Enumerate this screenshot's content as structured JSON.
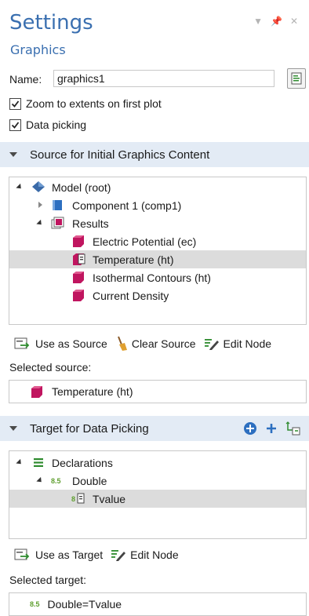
{
  "header": {
    "title": "Settings",
    "subtitle": "Graphics",
    "controls": [
      "dropdown-arrow",
      "pin",
      "close"
    ]
  },
  "name": {
    "label": "Name:",
    "value": "graphics1"
  },
  "options": [
    {
      "label": "Zoom to extents on first plot",
      "checked": true
    },
    {
      "label": "Data picking",
      "checked": true
    }
  ],
  "source_section": {
    "title": "Source for Initial Graphics Content",
    "tree": [
      {
        "label": "Model (root)",
        "icon": "model-icon",
        "expander": "open"
      },
      {
        "label": "Component 1 (comp1)",
        "icon": "component-icon",
        "expander": "closed"
      },
      {
        "label": "Results",
        "icon": "results-icon",
        "expander": "open"
      },
      {
        "label": "Electric Potential (ec)",
        "icon": "plot-group-icon"
      },
      {
        "label": "Temperature (ht)",
        "icon": "plot-group-icon",
        "selected": true
      },
      {
        "label": "Isothermal Contours (ht)",
        "icon": "plot-group-icon"
      },
      {
        "label": "Current Density",
        "icon": "plot-group-icon"
      }
    ],
    "toolbar": {
      "use_as_source": "Use as Source",
      "clear_source": "Clear Source",
      "edit_node": "Edit Node"
    },
    "selected_label": "Selected source:",
    "selected_value": "Temperature (ht)"
  },
  "target_section": {
    "title": "Target for Data Picking",
    "tree": [
      {
        "label": "Declarations",
        "icon": "declarations-icon",
        "expander": "open"
      },
      {
        "label": "Double",
        "icon_text": "8.5",
        "expander": "open"
      },
      {
        "label": "Tvalue",
        "icon_text": "8",
        "selected": true
      }
    ],
    "toolbar": {
      "use_as_target": "Use as Target",
      "edit_node": "Edit Node"
    },
    "selected_label": "Selected target:",
    "selected_value": "Double=Tvalue",
    "selected_icon_text": "8.5"
  },
  "colors": {
    "accent": "#3a6fb0",
    "section_bg": "#e3ebf5",
    "selection_bg": "#dcdcdc",
    "plot_icon": "#c0155f",
    "number_icon": "#5e9e2e"
  }
}
